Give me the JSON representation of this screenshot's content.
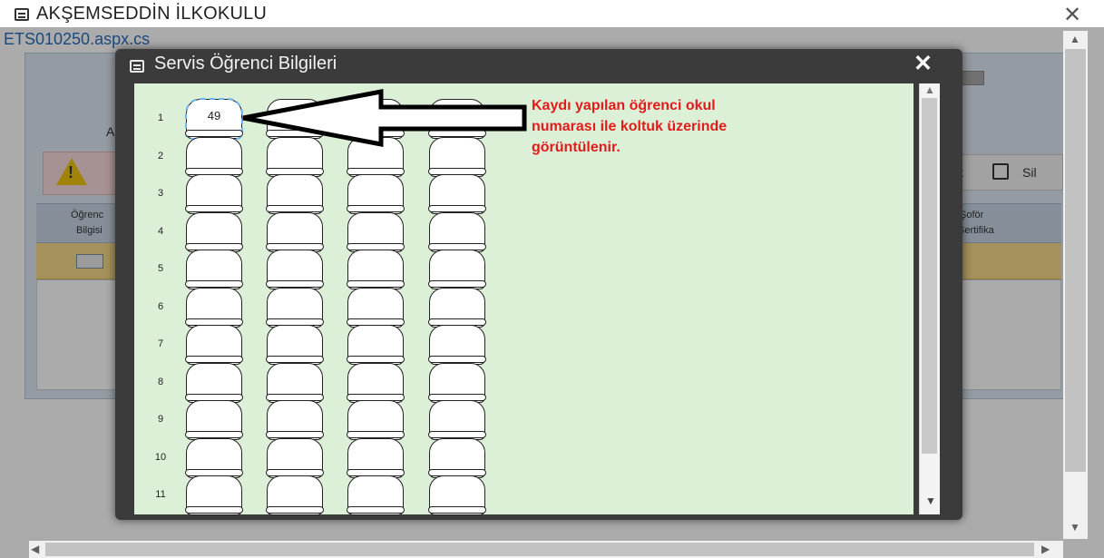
{
  "window": {
    "title": "AKŞEMSEDDİN İLKOKULU",
    "close_label": "✕",
    "url": "ETS010250.aspx.cs"
  },
  "background_page": {
    "letter": "A",
    "warning_mark": "!",
    "toolbar_t": "t",
    "delete_label": "Sil",
    "col1_line1": "Öğrenc",
    "col1_line2": "Bilgisi",
    "col2_line1": "Şoför",
    "col2_line2": "Sertifika"
  },
  "modal": {
    "title": "Servis Öğrenci Bilgileri",
    "close_label": "✕"
  },
  "seat_rows": [
    {
      "label": "1",
      "seats": [
        "49",
        "",
        "",
        ""
      ]
    },
    {
      "label": "2",
      "seats": [
        "",
        "",
        "",
        ""
      ]
    },
    {
      "label": "3",
      "seats": [
        "",
        "",
        "",
        ""
      ]
    },
    {
      "label": "4",
      "seats": [
        "",
        "",
        "",
        ""
      ]
    },
    {
      "label": "5",
      "seats": [
        "",
        "",
        "",
        ""
      ]
    },
    {
      "label": "6",
      "seats": [
        "",
        "",
        "",
        ""
      ]
    },
    {
      "label": "7",
      "seats": [
        "",
        "",
        "",
        ""
      ]
    },
    {
      "label": "8",
      "seats": [
        "",
        "",
        "",
        ""
      ]
    },
    {
      "label": "9",
      "seats": [
        "",
        "",
        "",
        ""
      ]
    },
    {
      "label": "10",
      "seats": [
        "",
        "",
        "",
        ""
      ]
    },
    {
      "label": "11",
      "seats": [
        "",
        "",
        "",
        ""
      ]
    }
  ],
  "annotation": {
    "line1": "Kaydı yapılan öğrenci okul",
    "line2": "numarası ile koltuk üzerinde",
    "line3": "görüntülenir."
  },
  "colors": {
    "annotation": "#e21b1b",
    "seat_area": "#dcefd7",
    "modal_frame": "#3b3b3b"
  },
  "icons": [
    "window-icon",
    "close-icon",
    "warning-icon",
    "save-icon",
    "person-card-icon",
    "scroll-up-icon",
    "scroll-down-icon",
    "scroll-left-icon",
    "scroll-right-icon",
    "arrow-icon"
  ]
}
